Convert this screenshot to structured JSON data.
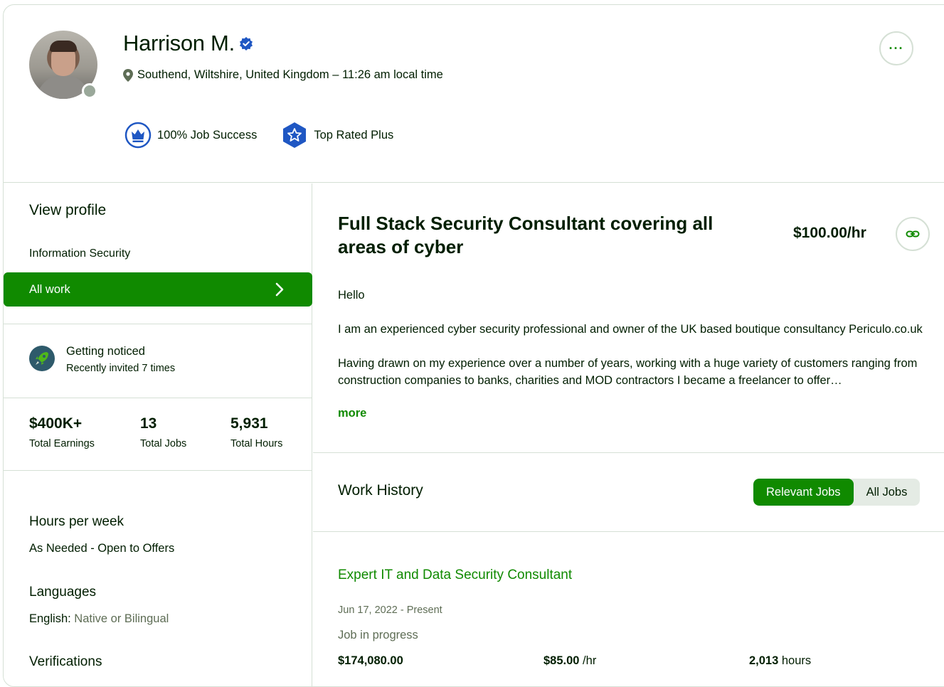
{
  "profile": {
    "name": "Harrison M.",
    "location": "Southend, Wiltshire, United Kingdom – 11:26 am local time",
    "badges": [
      {
        "label": "100% Job Success",
        "icon": "crown-icon"
      },
      {
        "label": "Top Rated Plus",
        "icon": "star-shield-icon"
      }
    ],
    "more_label": "···"
  },
  "sidebar": {
    "view_profile": "View profile",
    "specialized": "Information Security",
    "all_work": "All work",
    "noticed": {
      "title": "Getting noticed",
      "subtitle": "Recently invited 7 times"
    },
    "stats": [
      {
        "value": "$400K+",
        "label": "Total Earnings"
      },
      {
        "value": "13",
        "label": "Total Jobs"
      },
      {
        "value": "5,931",
        "label": "Total Hours"
      }
    ],
    "hours_per_week": {
      "title": "Hours per week",
      "value": "As Needed - Open to Offers"
    },
    "languages": {
      "title": "Languages",
      "items": [
        {
          "name": "English:",
          "level": "Native or Bilingual"
        }
      ]
    },
    "verifications_title": "Verifications"
  },
  "main": {
    "title": "Full Stack Security Consultant covering all areas of cyber",
    "rate": "$100.00/hr",
    "description": [
      "Hello",
      "I am an experienced cyber security professional and owner of the UK based boutique consultancy Periculo.co.uk",
      "Having drawn on my experience over a number of years, working with a huge variety of customers ranging from construction companies to banks, charities and MOD contractors I became a freelancer to offer…"
    ],
    "more_link": "more",
    "work_history": {
      "title": "Work History",
      "tabs": [
        "Relevant Jobs",
        "All Jobs"
      ],
      "job": {
        "title": "Expert IT and Data Security Consultant",
        "dates": "Jun 17, 2022 - Present",
        "status": "Job in progress",
        "earned": "$174,080.00",
        "rate": "$85.00",
        "rate_unit": " /hr",
        "hours": "2,013",
        "hours_unit": " hours"
      }
    }
  },
  "colors": {
    "brand_green": "#108a00",
    "verified_blue": "#1f57c3",
    "text": "#001e00",
    "muted": "#5e6d55",
    "border": "#d5e0d5"
  }
}
